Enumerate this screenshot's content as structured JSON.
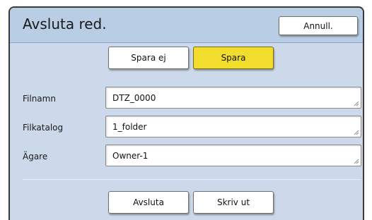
{
  "dialog": {
    "title": "Avsluta red.",
    "cancel_label": "Annull."
  },
  "save_options": {
    "no_save_label": "Spara ej",
    "save_label": "Spara",
    "selected": "Spara"
  },
  "fields": {
    "filename": {
      "label": "Filnamn",
      "value": "DTZ_0000"
    },
    "directory": {
      "label": "Filkatalog",
      "value": "1_folder"
    },
    "owner": {
      "label": "Ägare",
      "value": "Owner-1"
    }
  },
  "footer": {
    "end_label": "Avsluta",
    "print_label": "Skriv ut"
  },
  "colors": {
    "dialog_bg": "#ccd9ea",
    "header_bg": "#b9cde4",
    "selected_button": "#f2dc2c"
  }
}
